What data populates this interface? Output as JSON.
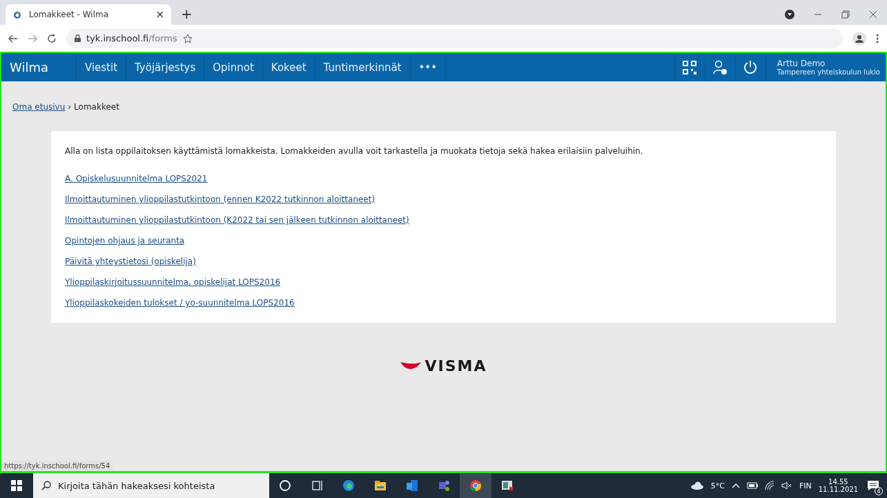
{
  "browser": {
    "tab_title": "Lomakkeet - Wilma",
    "tab_close": "×",
    "new_tab": "+",
    "url_host": "tyk.inschool.fi",
    "url_path": "/forms"
  },
  "navbar": {
    "brand": "Wilma",
    "items": [
      "Viestit",
      "Työjärjestys",
      "Opinnot",
      "Kokeet",
      "Tuntimerkinnät",
      "•••"
    ],
    "user_name": "Arttu Demo",
    "school": "Tampereen yhteiskoulun lukio"
  },
  "breadcrumb": {
    "link": "Oma etusivu",
    "separator": "›",
    "current": "Lomakkeet"
  },
  "intro": "Alla on lista oppilaitoksen käyttämistä lomakkeista. Lomakkeiden avulla voit tarkastella ja muokata tietoja sekä hakea erilaisiin palveluihin.",
  "forms": [
    "A. Opiskelusuunnitelma LOPS2021",
    "Ilmoittautuminen ylioppilastutkintoon (ennen K2022 tutkinnon aloittaneet)",
    "Ilmoittautuminen ylioppilastutkintoon (K2022 tai sen jälkeen tutkinnon aloittaneet)",
    "Opintojen ohjaus ja seuranta",
    "Päivitä yhteystietosi (opiskelija)",
    "Ylioppilaskirjoitussuunnitelma, opiskelijat LOPS2016",
    "Ylioppilaskokeiden tulokset / yo-suunnitelma LOPS2016"
  ],
  "footer_logo": "VISMA",
  "status_url": "https://tyk.inschool.fi/forms/54",
  "taskbar": {
    "search_placeholder": "Kirjoita tähän hakeaksesi kohteista",
    "temperature": "5°C",
    "language": "FIN",
    "time": "14.55",
    "date": "11.11.2021",
    "notification_count": "4"
  }
}
